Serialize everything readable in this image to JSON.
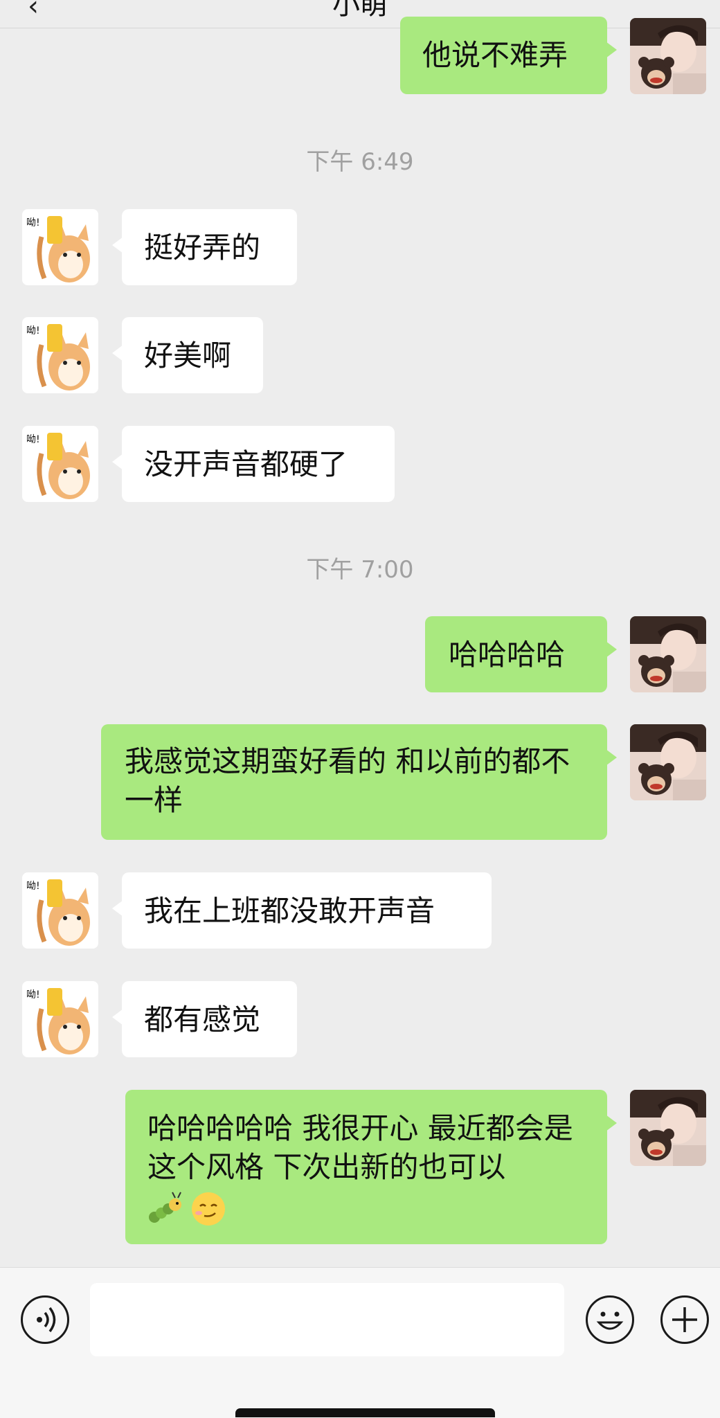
{
  "header": {
    "title": "小萌",
    "back_glyph": "‹"
  },
  "messages": [
    {
      "side": "right",
      "type": "text",
      "text": "他说不难弄"
    },
    {
      "type": "time",
      "text": "下午 6:49"
    },
    {
      "side": "left",
      "type": "text",
      "text": "挺好弄的"
    },
    {
      "side": "left",
      "type": "text",
      "text": "好美啊"
    },
    {
      "side": "left",
      "type": "text",
      "text": "没开声音都硬了"
    },
    {
      "type": "time",
      "text": "下午 7:00"
    },
    {
      "side": "right",
      "type": "text",
      "text": "哈哈哈哈"
    },
    {
      "side": "right",
      "type": "text",
      "text": "我感觉这期蛮好看的 和以前的都不一样"
    },
    {
      "side": "left",
      "type": "text",
      "text": "我在上班都没敢开声音"
    },
    {
      "side": "left",
      "type": "text",
      "text": "都有感觉"
    },
    {
      "side": "right",
      "type": "text",
      "text": "哈哈哈哈哈 我很开心 最近都会是这个风格 下次出新的也可以",
      "emojis": [
        "caterpillar-emoji",
        "smirk-face-emoji"
      ]
    }
  ],
  "input": {
    "placeholder": "",
    "value": ""
  },
  "icons": {
    "voice": "voice-icon",
    "emoji": "emoji-icon",
    "plus": "plus-icon"
  },
  "colors": {
    "background": "#ededed",
    "sent_bubble": "#a9e97f",
    "received_bubble": "#ffffff",
    "timestamp": "#a0a0a0"
  }
}
